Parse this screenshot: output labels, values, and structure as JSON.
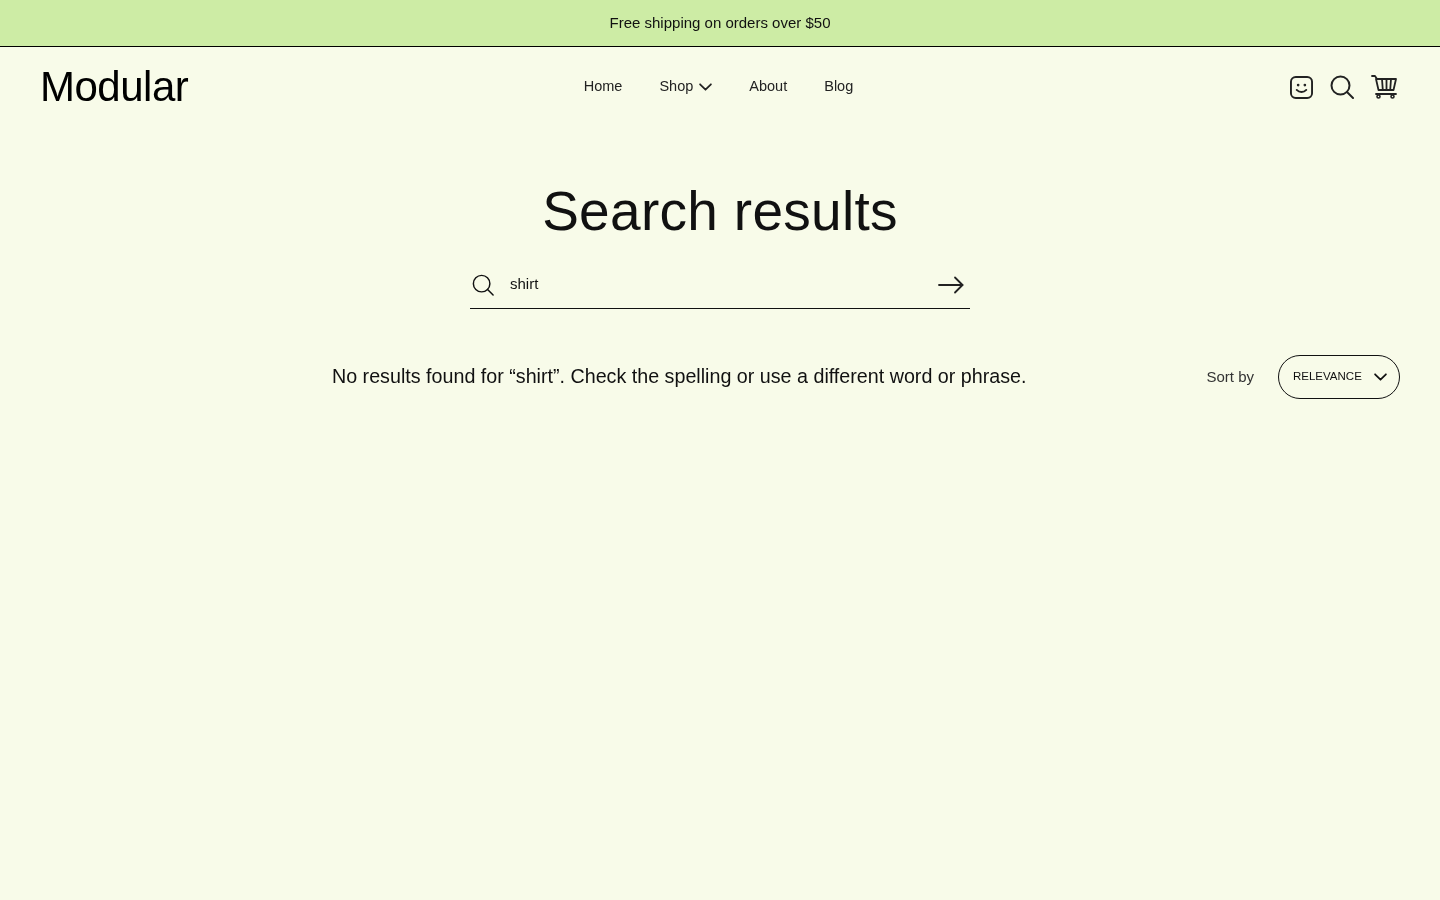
{
  "announcement": {
    "text": "Free shipping on orders over $50"
  },
  "header": {
    "logo": "Modular",
    "nav": [
      {
        "label": "Home",
        "dropdown": false
      },
      {
        "label": "Shop",
        "dropdown": true
      },
      {
        "label": "About",
        "dropdown": false
      },
      {
        "label": "Blog",
        "dropdown": false
      }
    ]
  },
  "search_page": {
    "title": "Search results",
    "search": {
      "value": "shirt"
    },
    "message": "No results found for “shirt”. Check the spelling or use a different word or phrase.",
    "sort": {
      "label": "Sort by",
      "value": "RELEVANCE"
    }
  }
}
